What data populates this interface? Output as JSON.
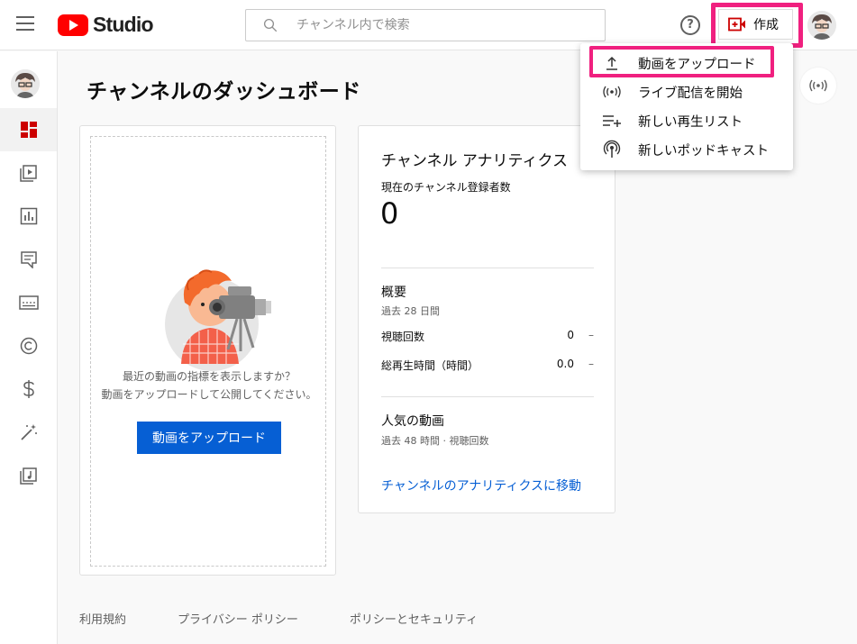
{
  "app": {
    "logo_text": "Studio"
  },
  "search": {
    "placeholder": "チャンネル内で検索"
  },
  "header": {
    "help_label": "?",
    "create_label": "作成"
  },
  "page": {
    "title": "チャンネルのダッシュボード"
  },
  "upload_card": {
    "prompt_line1": "最近の動画の指標を表示しますか？",
    "prompt_line2": "動画をアップロードして公開してください。",
    "button_label": "動画をアップロード"
  },
  "analytics": {
    "title": "チャンネル アナリティクス",
    "subscribers_label": "現在のチャンネル登録者数",
    "subscribers_value": "0",
    "summary": {
      "title": "概要",
      "period": "過去 28 日間",
      "rows": [
        {
          "label": "視聴回数",
          "value": "0",
          "delta": "–"
        },
        {
          "label": "総再生時間（時間）",
          "value": "0.0",
          "delta": "–"
        }
      ]
    },
    "top_videos": {
      "title": "人気の動画",
      "period": "過去 48 時間 · 視聴回数"
    },
    "link_label": "チャンネルのアナリティクスに移動"
  },
  "create_menu": {
    "items": [
      {
        "label": "動画をアップロード",
        "icon": "upload-icon"
      },
      {
        "label": "ライブ配信を開始",
        "icon": "live-icon"
      },
      {
        "label": "新しい再生リスト",
        "icon": "playlist-add-icon"
      },
      {
        "label": "新しいポッドキャスト",
        "icon": "podcast-icon"
      }
    ]
  },
  "sidebar": {
    "items": [
      {
        "icon": "dashboard-icon"
      },
      {
        "icon": "content-icon"
      },
      {
        "icon": "analytics-icon"
      },
      {
        "icon": "comments-icon"
      },
      {
        "icon": "subtitles-icon"
      },
      {
        "icon": "copyright-icon"
      },
      {
        "icon": "earn-icon"
      },
      {
        "icon": "customization-icon"
      },
      {
        "icon": "audio-library-icon"
      }
    ]
  },
  "footer": {
    "links": [
      "利用規約",
      "プライバシー ポリシー",
      "ポリシーとセキュリティ"
    ]
  },
  "colors": {
    "brand_red": "#ff0000",
    "highlight_pink": "#f0207f",
    "link_blue": "#065fd4",
    "dashboard_active": "#cc0000"
  }
}
